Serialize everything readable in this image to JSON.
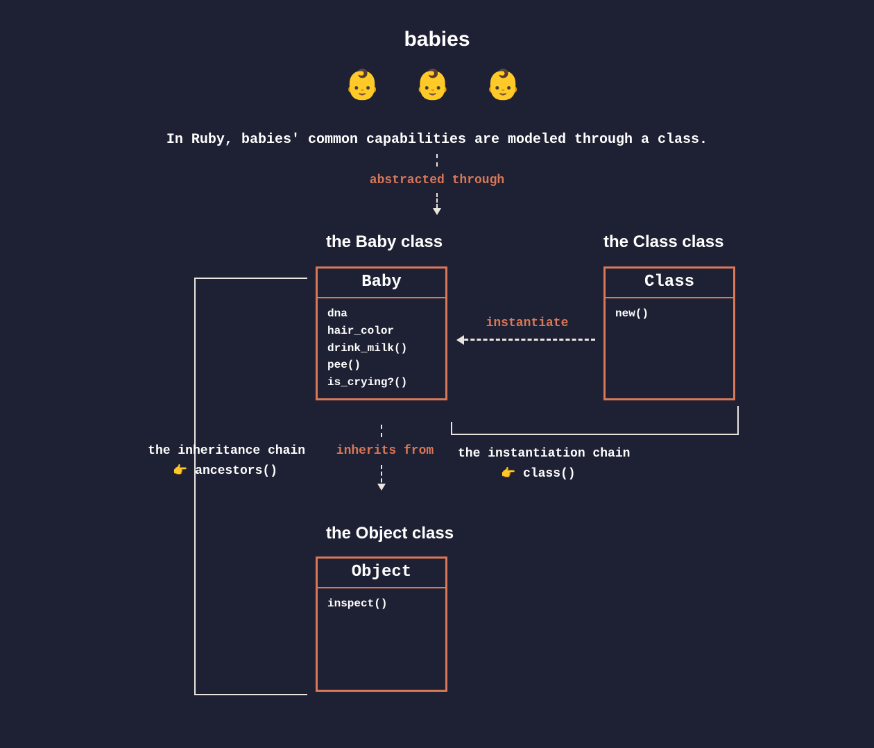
{
  "title": "babies",
  "baby_emoji": "👶",
  "description": "In Ruby, babies' common capabilities are modeled through a class.",
  "labels": {
    "abstracted": "abstracted through",
    "inherits": "inherits from",
    "instantiate": "instantiate"
  },
  "headings": {
    "baby": "the Baby class",
    "class": "the Class class",
    "object": "the Object class"
  },
  "boxes": {
    "baby": {
      "name": "Baby",
      "members": "dna\nhair_color\ndrink_milk()\npee()\nis_crying?()"
    },
    "class": {
      "name": "Class",
      "members": "new()"
    },
    "object": {
      "name": "Object",
      "members": "inspect()"
    }
  },
  "chains": {
    "inheritance": {
      "label": "the inheritance chain",
      "method": "ancestors()"
    },
    "instantiation": {
      "label": "the instantiation chain",
      "method": "class()"
    }
  },
  "finger_emoji": "👉"
}
